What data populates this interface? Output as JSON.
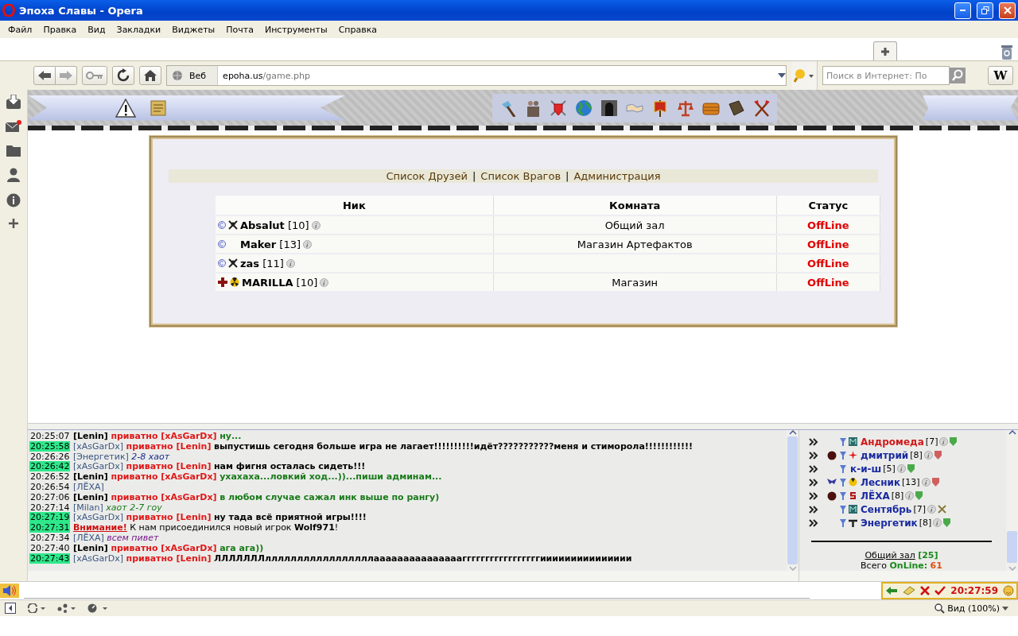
{
  "window": {
    "title": "Эпоха Славы - Opera"
  },
  "menu": [
    "Файл",
    "Правка",
    "Вид",
    "Закладки",
    "Виджеты",
    "Почта",
    "Инструменты",
    "Справка"
  ],
  "address_bar": {
    "scope": "Веб",
    "url_host": "epoha.us",
    "url_path": "/game.php",
    "search_placeholder": "Поиск в Интернет: По",
    "wiki_button": "W"
  },
  "friends": {
    "links": [
      "Список Друзей",
      "Список Врагов",
      "Администрация"
    ],
    "separator": "|",
    "columns": [
      "Ник",
      "Комната",
      "Статус"
    ],
    "rows": [
      {
        "nick": "Absalut",
        "level": "[10]",
        "room": "Общий зал",
        "status": "OffLine"
      },
      {
        "nick": "Maker",
        "level": "[13]",
        "room": "Магазин Артефактов",
        "status": "OffLine"
      },
      {
        "nick": "zas",
        "level": "[11]",
        "room": "",
        "status": "OffLine"
      },
      {
        "nick": "MARILLA",
        "level": "[10]",
        "room": "Магазин",
        "status": "OffLine"
      }
    ]
  },
  "chat": {
    "messages": [
      {
        "time": "20:25:07",
        "highlighted": false,
        "kind": "private_out",
        "sender": "[Lenin]",
        "private_label": "приватно [xAsGarDx]",
        "text": "ну...",
        "color": "#1a7a1a"
      },
      {
        "time": "20:25:58",
        "highlighted": true,
        "kind": "private_in",
        "sender": "[xAsGarDx]",
        "private_label": "приватно [Lenin]",
        "text": "выпустишь сегодня больше игра не лагает!!!!!!!!!!идёт???????????меня и стиморола!!!!!!!!!!!!",
        "color": "#000000"
      },
      {
        "time": "20:26:26",
        "highlighted": false,
        "kind": "public",
        "sender": "[Энергетик]",
        "text": "2-8 хаот",
        "color": "#1a2a8a"
      },
      {
        "time": "20:26:42",
        "highlighted": true,
        "kind": "private_in",
        "sender": "[xAsGarDx]",
        "private_label": "приватно [Lenin]",
        "text": "нам фигня осталась сидеть!!!",
        "color": "#000000"
      },
      {
        "time": "20:26:52",
        "highlighted": false,
        "kind": "private_out",
        "sender": "[Lenin]",
        "private_label": "приватно [xAsGarDx]",
        "text": "ухахаха...ловкий ход...))...пиши админам...",
        "color": "#1a7a1a"
      },
      {
        "time": "20:26:54",
        "highlighted": false,
        "kind": "public",
        "sender": "[ЛЁХА]"
      },
      {
        "time": "20:27:06",
        "highlighted": false,
        "kind": "private_out",
        "sender": "[Lenin]",
        "private_label": "приватно [xAsGarDx]",
        "text": "в любом случае сажал инк выше по рангу)",
        "color": "#1a7a1a"
      },
      {
        "time": "20:27:14",
        "highlighted": false,
        "kind": "public",
        "sender": "[Milan]",
        "text": "хаот 2-7 гоу",
        "color": "#1a7a1a"
      },
      {
        "time": "20:27:19",
        "highlighted": true,
        "kind": "private_in",
        "sender": "[xAsGarDx]",
        "private_label": "приватно [Lenin]",
        "text": "ну тада всё приятной игры!!!!",
        "color": "#000000"
      },
      {
        "time": "20:27:31",
        "highlighted": true,
        "kind": "system",
        "label": "Внимание!",
        "text": "К нам присоединился новый игрок **Wolf971**!"
      },
      {
        "time": "20:27:34",
        "highlighted": false,
        "kind": "public",
        "sender": "[ЛЁХА]",
        "text": "всем пивет",
        "color": "#7a1a8a"
      },
      {
        "time": "20:27:40",
        "highlighted": false,
        "kind": "private_out",
        "sender": "[Lenin]",
        "private_label": "приватно [xAsGarDx]",
        "text": "ага ага))",
        "color": "#1a7a1a"
      },
      {
        "time": "20:27:43",
        "highlighted": true,
        "kind": "private_in",
        "sender": "[xAsGarDx]",
        "private_label": "приватно [Lenin]",
        "text": "ЛЛЛЛЛЛЛлллллллллллллллллааааааааааааааагггггггггггггггггиииииииииииииии",
        "color": "#000000"
      }
    ]
  },
  "online": {
    "players": [
      {
        "name": "Андромеда",
        "color": "#d01818",
        "level": "[7]"
      },
      {
        "name": "дмитрий",
        "color": "#1a2aa0",
        "level": "[8]"
      },
      {
        "name": "к-и-ш",
        "color": "#1a2aa0",
        "level": "[5]"
      },
      {
        "name": "Лесник",
        "color": "#1a2aa0",
        "level": "[13]"
      },
      {
        "name": "ЛЁХА",
        "color": "#1a2aa0",
        "level": "[8]"
      },
      {
        "name": "Сентябрь",
        "color": "#1a2aa0",
        "level": "[7]"
      },
      {
        "name": "Энергетик",
        "color": "#1a2aa0",
        "level": "[8]"
      }
    ],
    "room_name": "Общий зал",
    "room_count": "[25]",
    "total_label": "Всего",
    "online_label": "OnLine:",
    "online_count": "61"
  },
  "clock": "20:27:59",
  "status_bar": {
    "zoom": "Вид (100%)"
  }
}
